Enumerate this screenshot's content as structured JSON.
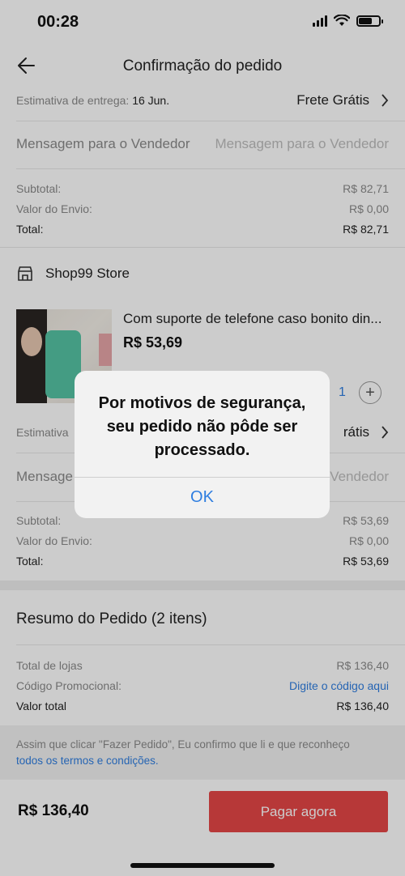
{
  "status": {
    "time": "00:28"
  },
  "header": {
    "title": "Confirmação do pedido"
  },
  "store1": {
    "delivery_label": "Estimativa de entrega:",
    "delivery_date": "16 Jun.",
    "shipping": "Frete Grátis",
    "message_label": "Mensagem para o Vendedor",
    "message_placeholder": "Mensagem para o Vendedor",
    "subtotal_label": "Subtotal:",
    "subtotal": "R$ 82,71",
    "shipping_label": "Valor do Envio:",
    "shipping_value": "R$ 0,00",
    "total_label": "Total:",
    "total": "R$ 82,71"
  },
  "store2": {
    "name": "Shop99 Store",
    "product_title": "Com suporte de telefone caso bonito din...",
    "product_price": "R$ 53,69",
    "quantity": "1",
    "delivery_label": "Estimativa",
    "shipping": "rátis",
    "message_label": "Mensage",
    "message_placeholder": "Vendedor",
    "subtotal_label": "Subtotal:",
    "subtotal": "R$ 53,69",
    "shipping_label": "Valor do Envio:",
    "shipping_value": "R$ 0,00",
    "total_label": "Total:",
    "total": "R$ 53,69"
  },
  "summary": {
    "title": "Resumo do Pedido (2 itens)",
    "stores_label": "Total de lojas",
    "stores_value": "R$ 136,40",
    "promo_label": "Código Promocional:",
    "promo_link": "Digite o código aqui",
    "total_label": "Valor total",
    "total_value": "R$ 136,40"
  },
  "terms": {
    "text": "Assim que clicar \"Fazer Pedido\", Eu confirmo que li e que reconheço",
    "link": "todos os termos e condições."
  },
  "footer": {
    "total": "R$ 136,40",
    "pay_button": "Pagar agora"
  },
  "dialog": {
    "message": "Por motivos de segurança, seu pedido não pôde ser processado.",
    "ok": "OK"
  },
  "colors": {
    "accent": "#e54646",
    "link": "#2f7ee0"
  },
  "icons": [
    "back-arrow-icon",
    "chevron-right-icon",
    "store-icon",
    "plus-icon",
    "wifi-icon",
    "battery-icon",
    "signal-icon"
  ]
}
